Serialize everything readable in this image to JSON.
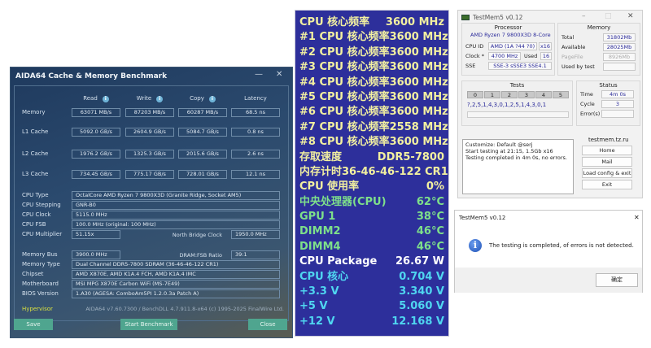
{
  "aida": {
    "title": "AIDA64 Cache & Memory Benchmark",
    "minimize": "—",
    "close_x": "✕",
    "headers": [
      "Read",
      "Write",
      "Copy",
      "Latency"
    ],
    "bench_rows": [
      {
        "label": "Memory",
        "values": [
          "63071 MB/s",
          "87203 MB/s",
          "60287 MB/s",
          "68.5 ns"
        ]
      },
      {
        "label": "L1 Cache",
        "values": [
          "5092.0 GB/s",
          "2604.9 GB/s",
          "5084.7 GB/s",
          "0.8 ns"
        ]
      },
      {
        "label": "L2 Cache",
        "values": [
          "1976.2 GB/s",
          "1325.3 GB/s",
          "2015.6 GB/s",
          "2.6 ns"
        ]
      },
      {
        "label": "L3 Cache",
        "values": [
          "734.45 GB/s",
          "775.17 GB/s",
          "728.01 GB/s",
          "12.1 ns"
        ]
      }
    ],
    "cpu_type_label": "CPU Type",
    "cpu_type": "OctalCore AMD Ryzen 7 9800X3D  (Granite Ridge, Socket AM5)",
    "cpu_stepping_label": "CPU Stepping",
    "cpu_stepping": "GNR-B0",
    "cpu_clock_label": "CPU Clock",
    "cpu_clock": "5115.0 MHz",
    "cpu_fsb_label": "CPU FSB",
    "cpu_fsb": "100.0 MHz  (original: 100 MHz)",
    "cpu_mult_label": "CPU Multiplier",
    "cpu_mult": "51.15x",
    "nb_clock_label": "North Bridge Clock",
    "nb_clock": "1950.0 MHz",
    "mem_bus_label": "Memory Bus",
    "mem_bus": "3900.0 MHz",
    "dram_ratio_label": "DRAM:FSB Ratio",
    "dram_ratio": "39:1",
    "mem_type_label": "Memory Type",
    "mem_type": "Dual Channel DDR5-7800 SDRAM  (36-46-46-122 CR1)",
    "chipset_label": "Chipset",
    "chipset": "AMD X870E, AMD K1A.4 FCH, AMD K1A.4 IMC",
    "mobo_label": "Motherboard",
    "mobo": "MSI MPG X870E Carbon WiFi (MS-7E49)",
    "bios_label": "BIOS Version",
    "bios": "1.A30  (AGESA: ComboAm5PI 1.2.0.3a Patch A)",
    "hypervisor": "Hypervisor",
    "footer": "AIDA64 v7.60.7300 / BenchDLL 4.7.911.8-x64  (c) 1995-2025 FinalWire Ltd.",
    "save": "Save",
    "start": "Start Benchmark",
    "close": "Close"
  },
  "monitor": {
    "colors": {
      "yellow": "#f2f0a0",
      "green": "#7ee08a",
      "white": "#ffffff",
      "cyan": "#4fd6f0",
      "bg": "#2d2f9b"
    },
    "rows": [
      {
        "label": "CPU 核心频率",
        "value": "3600 MHz",
        "color": "yellow"
      },
      {
        "label": "#1 CPU 核心频率",
        "value": "3600 MHz",
        "color": "yellow"
      },
      {
        "label": "#2 CPU 核心频率",
        "value": "3600 MHz",
        "color": "yellow"
      },
      {
        "label": "#3 CPU 核心频率",
        "value": "3600 MHz",
        "color": "yellow"
      },
      {
        "label": "#4 CPU 核心频率",
        "value": "3600 MHz",
        "color": "yellow"
      },
      {
        "label": "#5 CPU 核心频率",
        "value": "3600 MHz",
        "color": "yellow"
      },
      {
        "label": "#6 CPU 核心频率",
        "value": "3600 MHz",
        "color": "yellow"
      },
      {
        "label": "#7 CPU 核心频率",
        "value": "2558 MHz",
        "color": "yellow"
      },
      {
        "label": "#8 CPU 核心频率",
        "value": "3600 MHz",
        "color": "yellow"
      },
      {
        "label": "存取速度",
        "value": "DDR5-7800",
        "color": "yellow"
      },
      {
        "label": "内存计时",
        "value": "36-46-46-122 CR1",
        "color": "yellow"
      },
      {
        "label": "CPU 使用率",
        "value": "0%",
        "color": "yellow"
      },
      {
        "label": "中央处理器(CPU)",
        "value": "62°C",
        "color": "green"
      },
      {
        "label": "GPU 1",
        "value": "38°C",
        "color": "green"
      },
      {
        "label": "DIMM2",
        "value": "46°C",
        "color": "green"
      },
      {
        "label": "DIMM4",
        "value": "46°C",
        "color": "green"
      },
      {
        "label": "CPU Package",
        "value": "26.67 W",
        "color": "white"
      },
      {
        "label": "CPU 核心",
        "value": "0.704 V",
        "color": "cyan"
      },
      {
        "label": "+3.3 V",
        "value": "3.340 V",
        "color": "cyan"
      },
      {
        "label": "+5 V",
        "value": "5.060 V",
        "color": "cyan"
      },
      {
        "label": "+12 V",
        "value": "12.168 V",
        "color": "cyan"
      }
    ]
  },
  "testmem": {
    "title": "TestMem5 v0.12",
    "processor_title": "Processor",
    "cpu_name": "AMD Ryzen 7 9800X3D 8-Core",
    "cpuid_label": "CPU ID",
    "cpuid": "AMD  (1A ?44 ?0)",
    "threads": "x16",
    "clock_label": "Clock *",
    "clock": "4700 MHz",
    "used_label": "Used",
    "used": "16",
    "sse_label": "SSE",
    "sse": "SSE-3 sSSE3 SSE4.1",
    "memory_title": "Memory",
    "total_label": "Total",
    "total": "31802Mb",
    "avail_label": "Available",
    "avail": "28025Mb",
    "pagefile_label": "PageFile",
    "pagefile": "8926Mb",
    "usedby_label": "Used by test",
    "usedby": "",
    "tests_title": "Tests",
    "test_cols": [
      "0",
      "1",
      "2",
      "3",
      "4",
      "5"
    ],
    "sequence": "?,2,5,1,4,3,0,1,2,5,1,4,3,0,1",
    "status_title": "Status",
    "time_label": "Time",
    "time": "4m 0s",
    "cycle_label": "Cycle",
    "cycle": "3",
    "errors_label": "Error(s)",
    "errors": "",
    "log": [
      "Customize: Default @serj",
      "Start testing at 21:15, 1.5Gb x16",
      "Testing completed in 4m 0s, no errors."
    ],
    "site": "testmem.tz.ru",
    "home": "Home",
    "mail": "Mail",
    "load": "Load config & exit",
    "exit": "Exit"
  },
  "dialog": {
    "title": "TestMem5 v0.12",
    "message": "The testing is completed, of errors is not detected.",
    "ok": "确定"
  }
}
